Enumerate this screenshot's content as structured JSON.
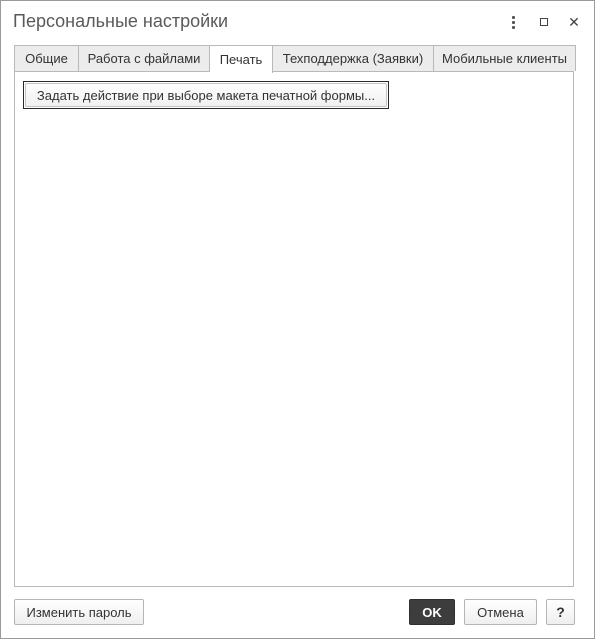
{
  "window": {
    "title": "Персональные настройки",
    "controls": {
      "more_icon": "vertical-dots-icon",
      "maximize_icon": "maximize-icon",
      "close_icon": "close-icon",
      "close_glyph": "✕"
    }
  },
  "tabs": [
    {
      "label": "Общие",
      "active": false
    },
    {
      "label": "Работа с файлами",
      "active": false
    },
    {
      "label": "Печать",
      "active": true
    },
    {
      "label": "Техподдержка (Заявки)",
      "active": false
    },
    {
      "label": "Мобильные клиенты",
      "active": false
    }
  ],
  "panel": {
    "action_button_label": "Задать действие при выборе макета печатной формы..."
  },
  "footer": {
    "change_password_label": "Изменить пароль",
    "ok_label": "OK",
    "cancel_label": "Отмена",
    "help_label": "?"
  },
  "colors": {
    "ok_background": "#3d3d3d",
    "tab_inactive": "#ececec",
    "border": "#b9b9b9"
  }
}
